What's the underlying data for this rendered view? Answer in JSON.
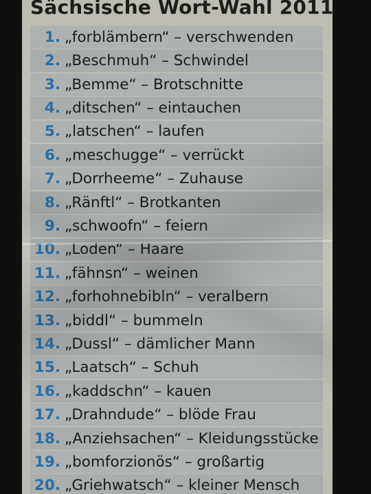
{
  "title": "Sächsische Wort-Wahl 2011",
  "items": [
    {
      "num": "1.",
      "text": "„forblämbern“ – verschwenden"
    },
    {
      "num": "2.",
      "text": "„Beschmuh“ – Schwindel"
    },
    {
      "num": "3.",
      "text": "„Bemme“ – Brotschnitte"
    },
    {
      "num": "4.",
      "text": "„ditschen“ – eintauchen"
    },
    {
      "num": "5.",
      "text": "„latschen“ – laufen"
    },
    {
      "num": "6.",
      "text": "„meschugge“ – verrückt"
    },
    {
      "num": "7.",
      "text": "„Dorrheeme“ – Zuhause"
    },
    {
      "num": "8.",
      "text": "„Ränftl“ – Brotkanten"
    },
    {
      "num": "9.",
      "text": "„schwoofn“ – feiern"
    },
    {
      "num": "10.",
      "text": "„Loden“ – Haare"
    },
    {
      "num": "11.",
      "text": "„fähnsn“ – weinen"
    },
    {
      "num": "12.",
      "text": "„forhohnebibln“ – veralbern"
    },
    {
      "num": "13.",
      "text": "„biddl“ – bummeln"
    },
    {
      "num": "14.",
      "text": "„Dussl“ – dämlicher Mann"
    },
    {
      "num": "15.",
      "text": "„Laatsch“ – Schuh"
    },
    {
      "num": "16.",
      "text": "„kaddschn“ – kauen"
    },
    {
      "num": "17.",
      "text": "„Drahndude“ – blöde Frau"
    },
    {
      "num": "18.",
      "text": "„Anziehsachen“ – Kleidungsstücke"
    },
    {
      "num": "19.",
      "text": "„bomforzionös“ – großartig"
    },
    {
      "num": "20.",
      "text": "„Griehwatsch“ – kleiner Mensch"
    }
  ]
}
